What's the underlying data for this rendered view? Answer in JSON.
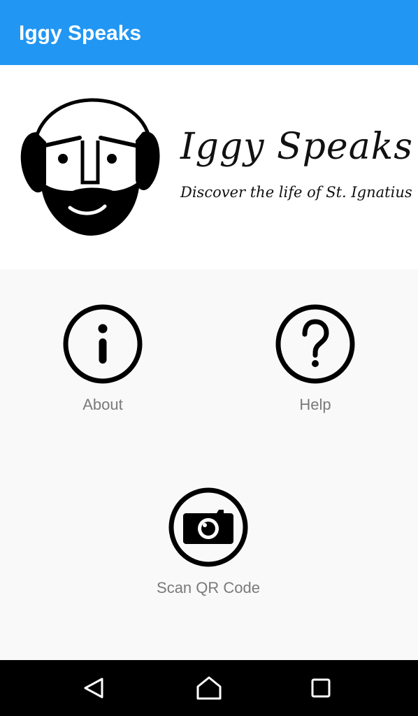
{
  "app_bar": {
    "title": "Iggy Speaks",
    "background": "#2196f3"
  },
  "banner": {
    "title": "Iggy Speaks",
    "subtitle": "Discover the life of St. Ignatius",
    "logo_icon": "st-ignatius-face-logo"
  },
  "menu": {
    "about": {
      "label": "About",
      "icon": "info-circle-icon"
    },
    "help": {
      "label": "Help",
      "icon": "question-circle-icon"
    },
    "scan": {
      "label": "Scan QR Code",
      "icon": "camera-circle-icon"
    }
  },
  "nav_bar": {
    "buttons": [
      "back-triangle-icon",
      "home-icon",
      "recents-square-icon"
    ]
  }
}
